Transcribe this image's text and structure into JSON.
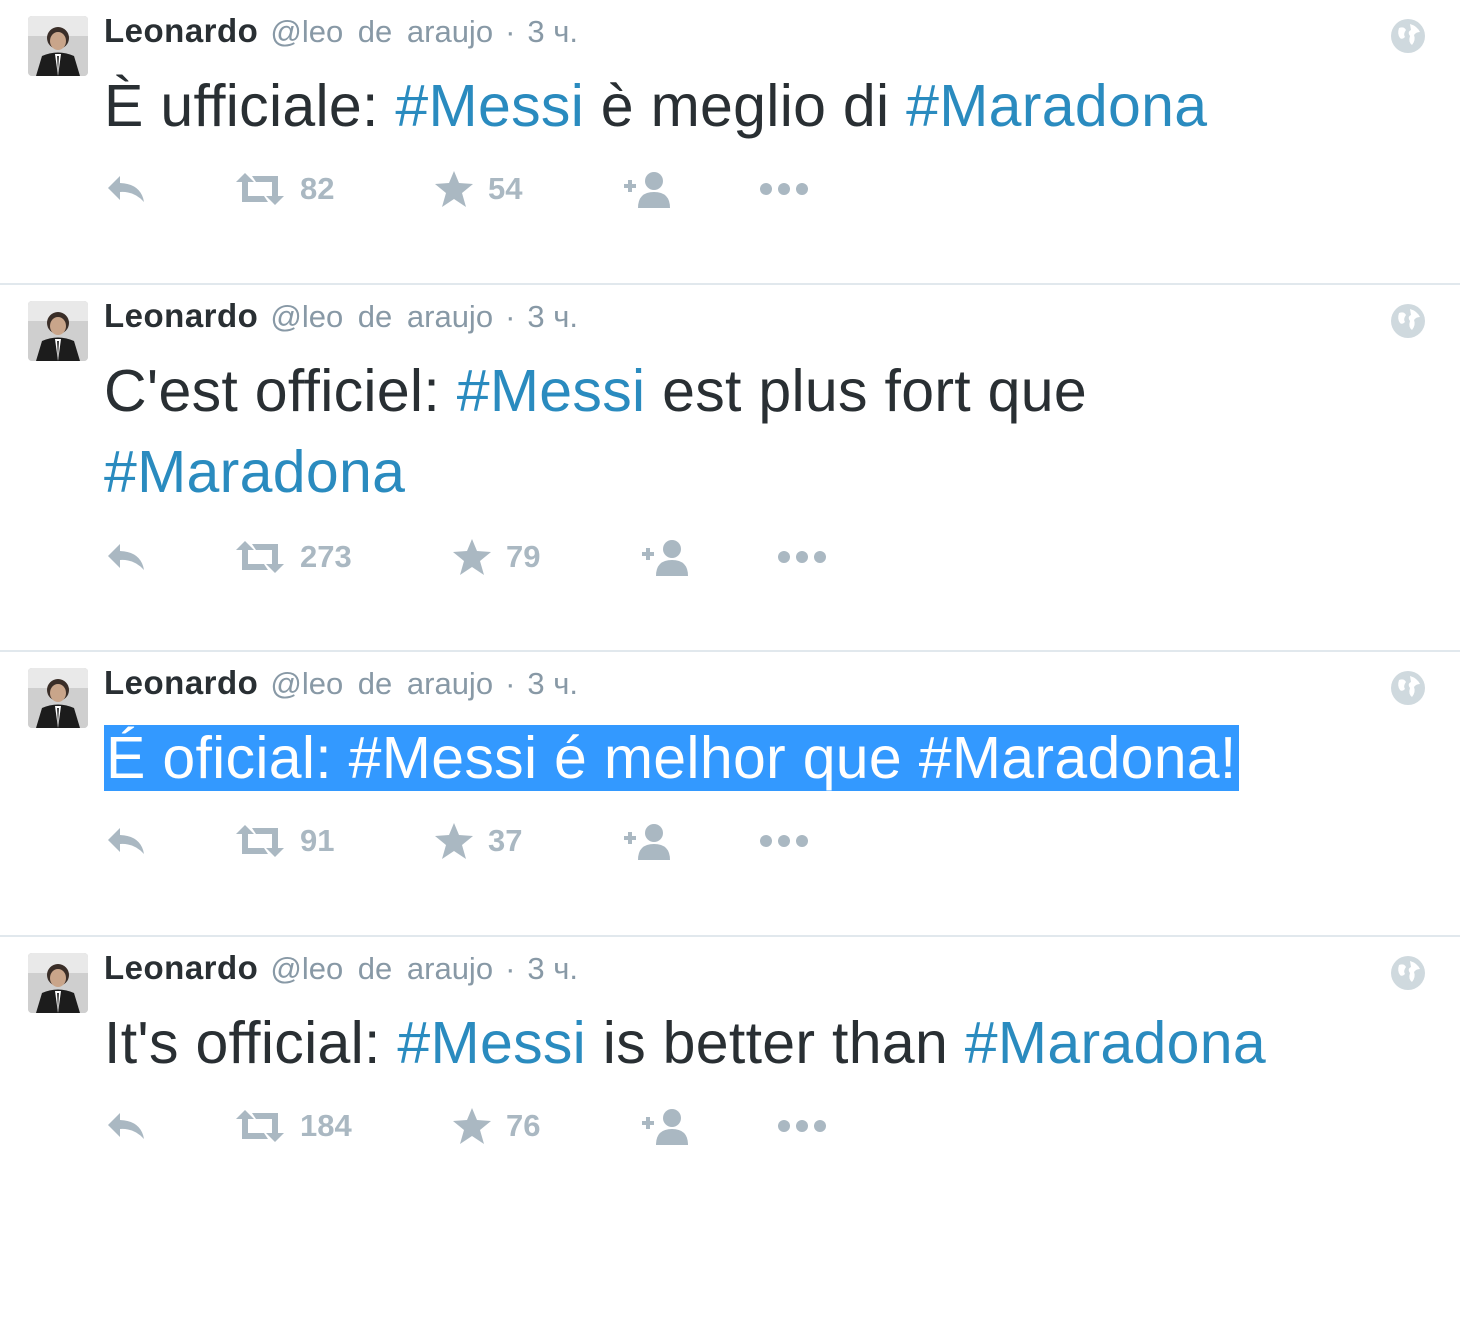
{
  "tweets": [
    {
      "fullname": "Leonardo",
      "screenname": "@leo de araujo",
      "separator": "·",
      "time": "3 ч.",
      "text_parts": [
        "È ufficiale: ",
        "#Messi",
        " è meglio di ",
        "#Maradona"
      ],
      "retweets": "82",
      "favorites": "54"
    },
    {
      "fullname": "Leonardo",
      "screenname": "@leo de araujo",
      "separator": "·",
      "time": "3 ч.",
      "text_parts": [
        "C'est officiel: ",
        "#Messi",
        " est plus fort que ",
        "#Maradona"
      ],
      "retweets": "273",
      "favorites": "79"
    },
    {
      "fullname": "Leonardo",
      "screenname": "@leo de araujo",
      "separator": "·",
      "time": "3 ч.",
      "text_parts": [
        "É oficial: ",
        "#Messi",
        " é melhor que ",
        "#Maradona",
        "!"
      ],
      "retweets": "91",
      "favorites": "37",
      "selected": true
    },
    {
      "fullname": "Leonardo",
      "screenname": "@leo de araujo",
      "separator": "·",
      "time": "3 ч.",
      "text_parts": [
        "It's official: ",
        "#Messi",
        " is better than ",
        "#Maradona"
      ],
      "retweets": "184",
      "favorites": "76"
    }
  ],
  "icons": {
    "reply": "reply-icon",
    "retweet": "retweet-icon",
    "favorite": "star-icon",
    "follow": "follow-icon",
    "more": "more-icon",
    "globe": "globe-icon"
  },
  "colors": {
    "hashtag": "#2a8bbf",
    "text": "#292f33",
    "meta": "#8899a6",
    "action": "#aab8c2",
    "selection": "#3399ff",
    "divider": "#e1e8ed"
  }
}
